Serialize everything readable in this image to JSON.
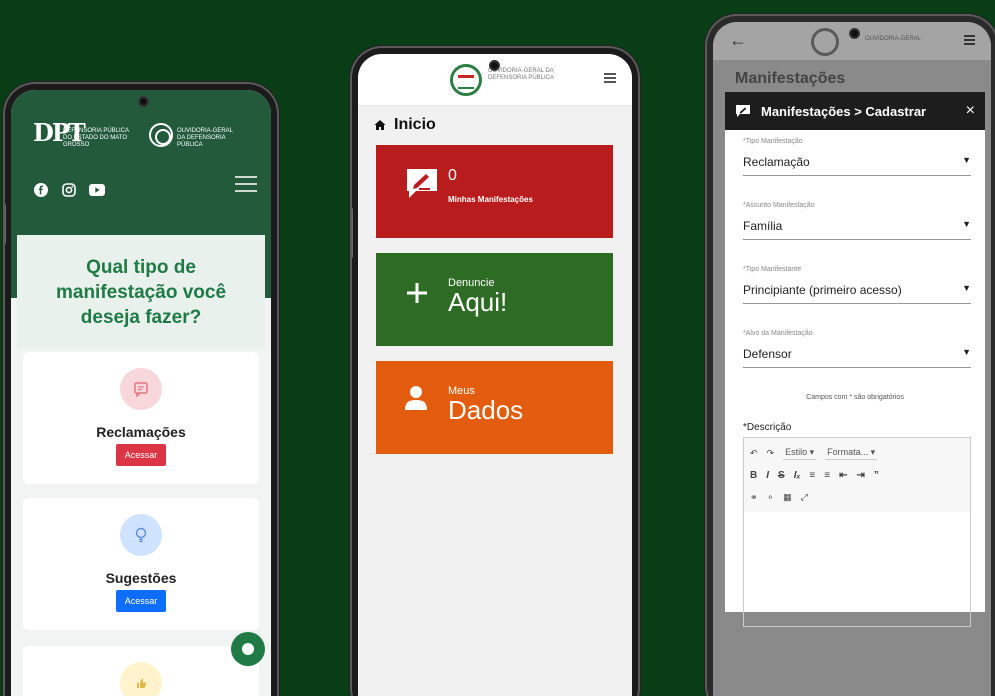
{
  "phone1": {
    "org_logo_text": "DEFENSORIA PÚBLICA DO ESTADO DO MATO GROSSO",
    "seal_text": "OUVIDORIA-GERAL DA DEFENSORIA PÚBLICA",
    "question": "Qual tipo de manifestação você deseja fazer?",
    "cards": [
      {
        "title": "Reclamações",
        "button": "Acessar",
        "color": "#dc3545",
        "circle": "#f8d7da"
      },
      {
        "title": "Sugestões",
        "button": "Acessar",
        "color": "#0d6efd",
        "circle": "#cfe2ff"
      }
    ]
  },
  "phone2": {
    "seal_text": "OUVIDORIA-GERAL DA DEFENSORIA PÚBLICA",
    "breadcrumb": "Inicio",
    "tiles": [
      {
        "count": "0",
        "label": "Minhas Manifestações",
        "color": "#b91c1c"
      },
      {
        "small": "Denuncie",
        "big": "Aqui!",
        "color": "#2e6b24"
      },
      {
        "small": "Meus",
        "big": "Dados",
        "color": "#e35b0c"
      }
    ]
  },
  "phone3": {
    "seal_text": "OUVIDORIA-GERAL",
    "background_title": "Manifestações",
    "modal_title": "Manifestações > Cadastrar",
    "fields": [
      {
        "label": "*Tipo Manifestação",
        "value": "Reclamação"
      },
      {
        "label": "*Assunto Manifestação",
        "value": "Família"
      },
      {
        "label": "*Tipo Manifestante",
        "value": "Principiante (primeiro acesso)"
      },
      {
        "label": "*Alvo da Manifestação",
        "value": "Defensor"
      }
    ],
    "required_note": "Campos com * são obrigatórios",
    "description_label": "*Descrição",
    "editor_style": "Estilo",
    "editor_format": "Formata..."
  }
}
